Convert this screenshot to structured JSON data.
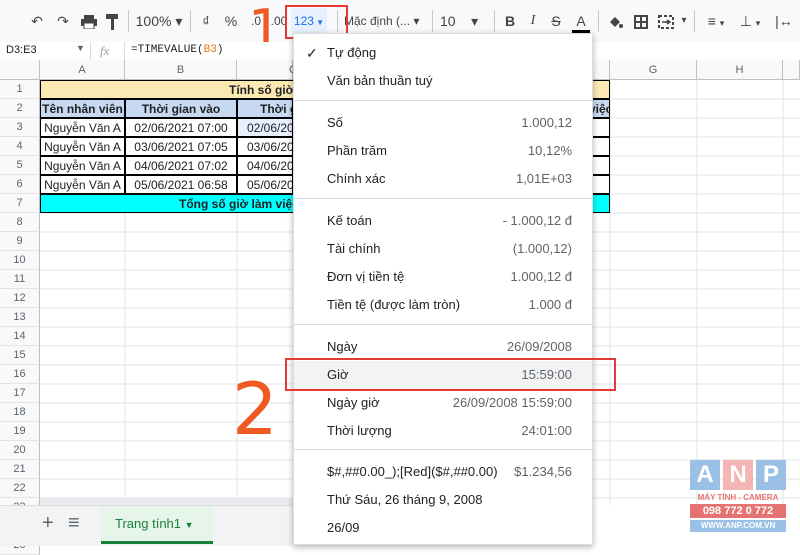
{
  "toolbar": {
    "zoom": "100%",
    "currency": "₫",
    "percent": "%",
    "decimal_dec": ".0",
    "decimal_inc": ".00",
    "format_more": "123",
    "font": "Mặc định (...",
    "font_size": "10",
    "bold": "B",
    "italic": "I",
    "strike": "S",
    "text_color": "A"
  },
  "annotations": {
    "one": "1",
    "two": "2"
  },
  "formula_bar": {
    "cell_ref": "D3:E3",
    "fx": "fx",
    "formula_prefix": "=TIMEVALUE(",
    "formula_ref": "B3",
    "formula_suffix": ")"
  },
  "columns": [
    "A",
    "B",
    "C",
    "G",
    "H"
  ],
  "rows": [
    "1",
    "2",
    "3",
    "4",
    "5",
    "6",
    "7",
    "8",
    "9",
    "10",
    "11",
    "12",
    "13",
    "14",
    "15",
    "16",
    "17",
    "18",
    "19",
    "20",
    "21",
    "22",
    "23",
    "24",
    "25"
  ],
  "sheet": {
    "title": "Tính số giờ",
    "title_right": "việc",
    "headers": [
      "Tên nhân viên",
      "Thời gian vào",
      "Thời g"
    ],
    "data": [
      [
        "Nguyễn Văn A",
        "02/06/2021 07:00",
        "02/06/20"
      ],
      [
        "Nguyễn Văn A",
        "03/06/2021 07:05",
        "03/06/20"
      ],
      [
        "Nguyễn Văn A",
        "04/06/2021 07:02",
        "04/06/20"
      ],
      [
        "Nguyễn Văn A",
        "05/06/2021 06:58",
        "05/06/20"
      ]
    ],
    "total": "Tổng số giờ làm việc"
  },
  "menu": {
    "check": "✓",
    "items": [
      {
        "label": "Tự động",
        "value": ""
      },
      {
        "label": "Văn bản thuần tuý",
        "value": ""
      },
      {
        "label": "Số",
        "value": "1.000,12"
      },
      {
        "label": "Phần trăm",
        "value": "10,12%"
      },
      {
        "label": "Chính xác",
        "value": "1,01E+03"
      },
      {
        "label": "Kế toán",
        "value": "- 1.000,12 đ"
      },
      {
        "label": "Tài chính",
        "value": "(1.000,12)"
      },
      {
        "label": "Đơn vị tiền tệ",
        "value": "1.000,12 đ"
      },
      {
        "label": "Tiền tệ (được làm tròn)",
        "value": "1.000 đ"
      },
      {
        "label": "Ngày",
        "value": "26/09/2008"
      },
      {
        "label": "Giờ",
        "value": "15:59:00"
      },
      {
        "label": "Ngày giờ",
        "value": "26/09/2008 15:59:00"
      },
      {
        "label": "Thời lượng",
        "value": "24:01:00"
      },
      {
        "label": "$#,##0.00_);[Red]($#,##0.00)",
        "value": "$1.234,56"
      },
      {
        "label": "Thứ Sáu, 26 tháng 9, 2008",
        "value": ""
      },
      {
        "label": "26/09",
        "value": ""
      }
    ]
  },
  "tabs": {
    "add": "+",
    "list": "≡",
    "sheet_name": "Trang tính1"
  },
  "logo": {
    "letters": [
      "A",
      "N",
      "P"
    ],
    "tagline": "MÁY TÍNH - CAMERA",
    "phone": "098 772 0 772",
    "site": "WWW.ANP.COM.VN"
  },
  "colors": {
    "title_fill": "#fce8b2",
    "header_fill": "#c6d9f1",
    "total_fill": "#00ffff",
    "accent": "#e53935",
    "annot": "#ef5a24",
    "green": "#188038"
  }
}
